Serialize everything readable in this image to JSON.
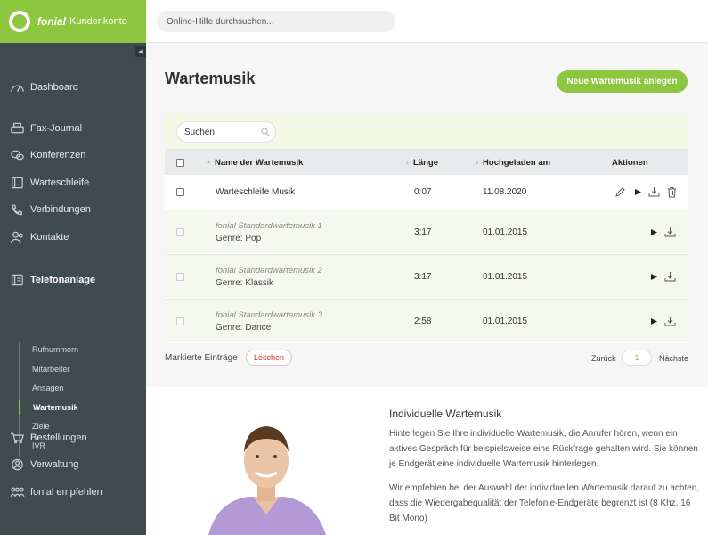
{
  "brand": {
    "name": "fonial",
    "subtitle": "Kundenkonto",
    "color": "#8dc63f"
  },
  "top_search": {
    "placeholder": "Online-Hilfe durchsuchen..."
  },
  "sidebar": {
    "collapse_icon": "chevron-left-icon",
    "items": [
      {
        "label": "Dashboard",
        "icon": "speedometer-icon"
      },
      {
        "label": "Fax-Journal",
        "icon": "fax-icon"
      },
      {
        "label": "Konferenzen",
        "icon": "chat-bubbles-icon"
      },
      {
        "label": "Warteschleife",
        "icon": "queue-icon"
      },
      {
        "label": "Verbindungen",
        "icon": "phone-icon"
      },
      {
        "label": "Kontakte",
        "icon": "contacts-icon"
      },
      {
        "label": "Telefonanlage",
        "icon": "pbx-icon",
        "active": true
      },
      {
        "label": "Bestellungen",
        "icon": "cart-icon"
      },
      {
        "label": "Verwaltung",
        "icon": "user-circle-icon"
      },
      {
        "label": "fonial empfehlen",
        "icon": "users-recommend-icon"
      }
    ],
    "sub_items": [
      {
        "label": "Rufnummern"
      },
      {
        "label": "Mitarbeiter"
      },
      {
        "label": "Ansagen"
      },
      {
        "label": "Wartemusik",
        "active": true
      },
      {
        "label": "Ziele"
      },
      {
        "label": "IVR"
      }
    ]
  },
  "main": {
    "title": "Wartemusik",
    "new_button": "Neue Wartemusik anlegen",
    "filter": {
      "placeholder": "Suchen"
    },
    "columns": [
      "Name der Wartemusik",
      "Länge",
      "Hochgeladen am",
      "Aktionen"
    ],
    "rows": [
      {
        "name": "Warteschleife Musik",
        "length": "0:07",
        "date": "11.08.2020"
      },
      {
        "name": "fonial Standardwartemusik 1",
        "genre": "Genre: Pop",
        "length": "3:17",
        "date": "01.01.2015"
      },
      {
        "name": "fonial Standardwartemusik 2",
        "genre": "Genre: Klassik",
        "length": "3:17",
        "date": "01.01.2015"
      },
      {
        "name": "fonial Standardwartemusik 3",
        "genre": "Genre: Dance",
        "length": "2:58",
        "date": "01.01.2015"
      }
    ],
    "bulk": {
      "label": "Markierte Einträge",
      "delete": "Löschen"
    },
    "pager": {
      "prev": "Zurück",
      "page": "1",
      "next": "Nächste"
    }
  },
  "info": {
    "title": "Individuelle Wartemusik",
    "p1": "Hinterlegen Sie Ihre individuelle Wartemusik, die Anrufer hören, wenn ein aktives Gespräch für beispielsweise eine Rückfrage gehalten wird. Sie können je Endgerät eine individuelle Wartemusik hinterlegen.",
    "p2": "Wir empfehlen bei der Auswahl der individuellen Wartemusik darauf zu achten, dass die Wiedergabequalität der Telefonie-Endgeräte begrenzt ist (8 Khz, 16 Bit Mono)"
  }
}
